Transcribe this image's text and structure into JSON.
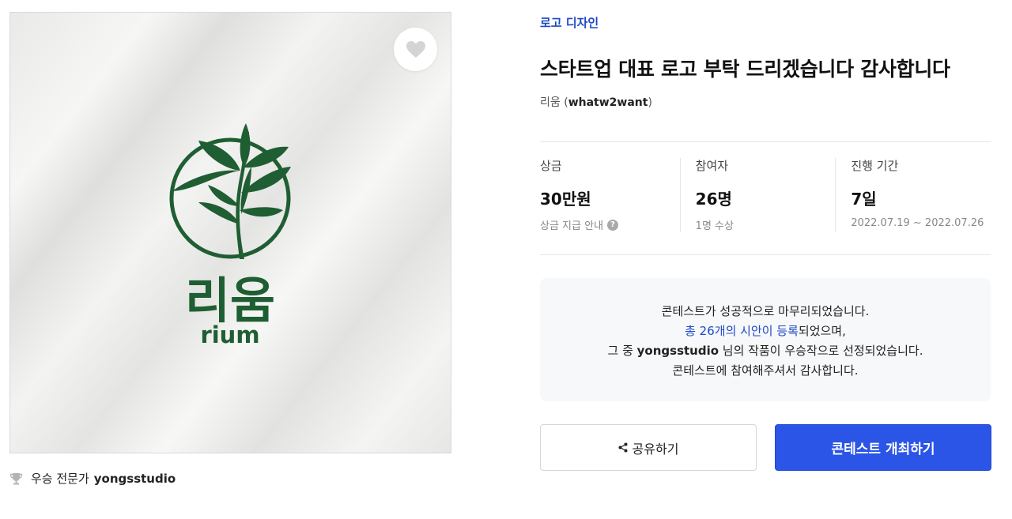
{
  "artwork": {
    "brand_korean": "리움",
    "brand_english": "rium",
    "colors": {
      "logo_green": "#1f5e32",
      "background": "#efefee"
    }
  },
  "favorite": {
    "icon": "heart-icon"
  },
  "winner": {
    "icon": "trophy-icon",
    "label": "우승 전문가",
    "name": "yongsstudio"
  },
  "contest": {
    "category": "로고 디자인",
    "title": "스타트업 대표 로고 부탁 드리겠습니다 감사합니다",
    "host_name": "리움",
    "host_id": "whatw2want"
  },
  "stats": [
    {
      "label": "상금",
      "value": "30만원",
      "sub": "상금 지급 안내",
      "help": "?"
    },
    {
      "label": "참여자",
      "value": "26명",
      "sub": "1명 수상"
    },
    {
      "label": "진행 기간",
      "value": "7일",
      "sub": "2022.07.19 ~ 2022.07.26"
    }
  ],
  "notice": {
    "line1": "콘테스트가 성공적으로 마무리되었습니다.",
    "line2_link": "총 26개의 시안이 등록",
    "line2_rest": "되었으며,",
    "line3_pre": "그 중 ",
    "line3_name": "yongsstudio",
    "line3_post": " 님의 작품이 우승작으로 선정되었습니다.",
    "line4": "콘테스트에 참여해주셔서 감사합니다."
  },
  "buttons": {
    "share": "공유하기",
    "share_icon": "share-icon",
    "host": "콘테스트 개최하기"
  },
  "accent": "#2b55e6"
}
